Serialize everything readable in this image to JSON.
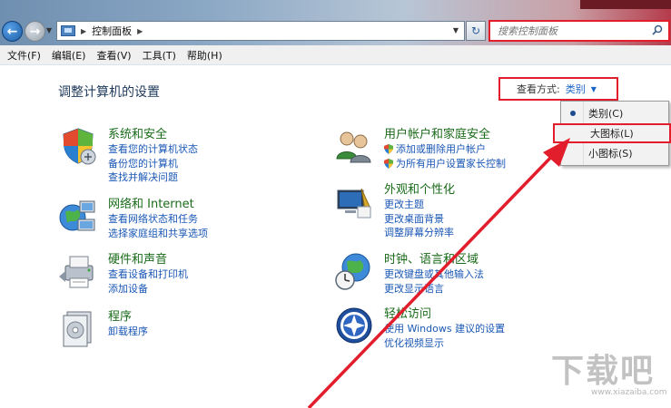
{
  "address_bar": {
    "path_item": "控制面板",
    "search_placeholder": "搜索控制面板"
  },
  "menu": [
    "文件(F)",
    "编辑(E)",
    "查看(V)",
    "工具(T)",
    "帮助(H)"
  ],
  "page": {
    "title": "调整计算机的设置",
    "view_by_label": "查看方式:",
    "view_by_value": "类别"
  },
  "view_dropdown": {
    "options": [
      "类别(C)",
      "大图标(L)",
      "小图标(S)"
    ],
    "selected": "类别(C)"
  },
  "categories": {
    "system": {
      "title": "系统和安全",
      "links": [
        "查看您的计算机状态",
        "备份您的计算机",
        "查找并解决问题"
      ]
    },
    "network": {
      "title": "网络和 Internet",
      "links": [
        "查看网络状态和任务",
        "选择家庭组和共享选项"
      ]
    },
    "hardware": {
      "title": "硬件和声音",
      "links": [
        "查看设备和打印机",
        "添加设备"
      ]
    },
    "programs": {
      "title": "程序",
      "links": [
        "卸载程序"
      ]
    },
    "accounts": {
      "title": "用户帐户和家庭安全",
      "links": [
        "添加或删除用户帐户",
        "为所有用户设置家长控制"
      ]
    },
    "appearance": {
      "title": "外观和个性化",
      "links": [
        "更改主题",
        "更改桌面背景",
        "调整屏幕分辨率"
      ]
    },
    "clock": {
      "title": "时钟、语言和区域",
      "links": [
        "更改键盘或其他输入法",
        "更改显示语言"
      ]
    },
    "ease": {
      "title": "轻松访问",
      "links": [
        "使用 Windows 建议的设置",
        "优化视频显示"
      ]
    }
  },
  "watermark": {
    "text": "下载吧",
    "url": "www.xiazaiba.com"
  },
  "colors": {
    "annotation_red": "#e21d2c",
    "link_blue": "#1a57b5",
    "category_green": "#1a6b1a"
  }
}
